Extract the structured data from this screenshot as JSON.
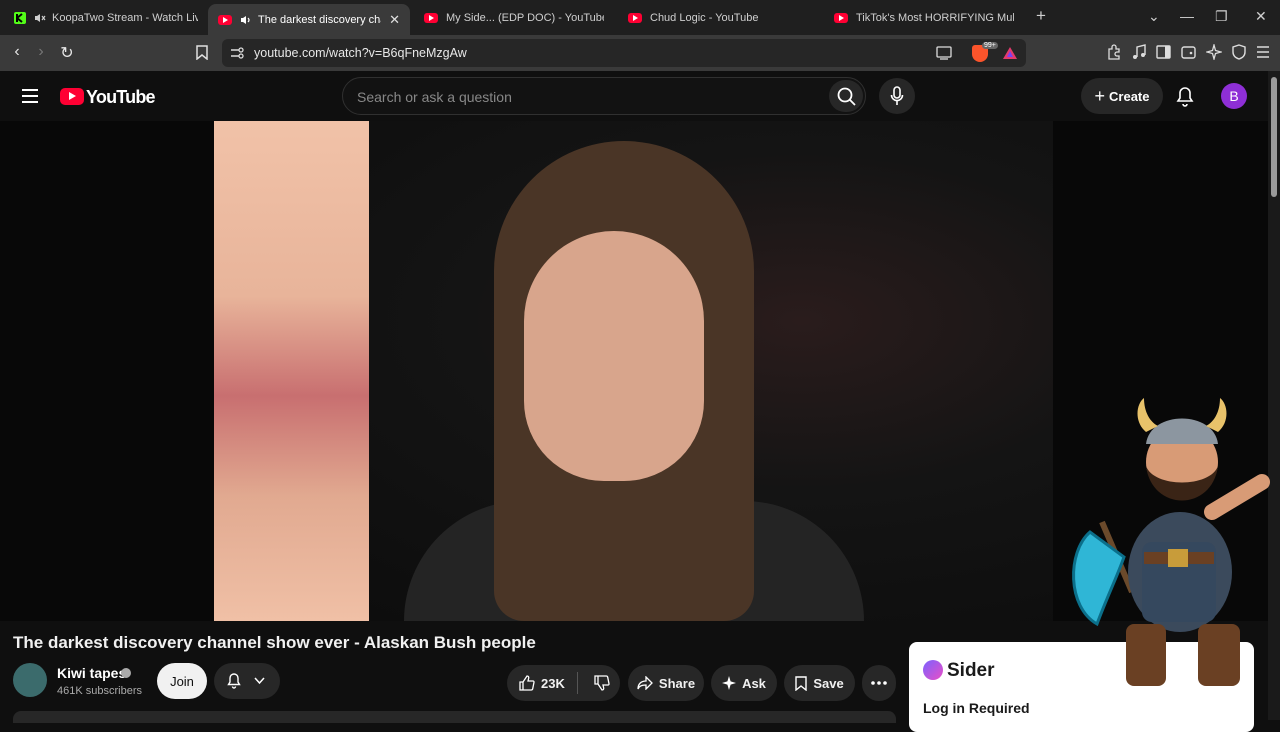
{
  "browser": {
    "tabs": [
      {
        "title": "KoopaTwo Stream - Watch Live o",
        "icon": "kick-icon",
        "muted": true
      },
      {
        "title": "The darkest discovery channe",
        "icon": "youtube-icon",
        "audio": true,
        "active": true
      },
      {
        "title": "My Side... (EDP DOC) - YouTube",
        "icon": "youtube-icon"
      },
      {
        "title": "Chud Logic - YouTube",
        "icon": "youtube-icon"
      },
      {
        "title": "TikTok's Most HORRIFYING Mukbang",
        "icon": "youtube-icon"
      }
    ],
    "new_tab": "+",
    "url": "youtube.com/watch?v=B6qFneMzgAw",
    "brave_badge": "99+"
  },
  "header": {
    "logo_text": "YouTube",
    "search_placeholder": "Search or ask a question",
    "create_label": "Create",
    "avatar_letter": "B"
  },
  "video": {
    "title": "The darkest discovery channel show ever - Alaskan Bush people"
  },
  "channel": {
    "name": "Kiwi tapes",
    "subscribers": "461K subscribers",
    "join_label": "Join"
  },
  "actions": {
    "likes": "23K",
    "share_label": "Share",
    "ask_label": "Ask",
    "save_label": "Save"
  },
  "sider": {
    "brand": "Sider",
    "message": "Log in Required"
  },
  "colors": {
    "youtube_red": "#ff0033",
    "avatar_purple": "#8e2fd6",
    "kick_green": "#53fc18"
  }
}
